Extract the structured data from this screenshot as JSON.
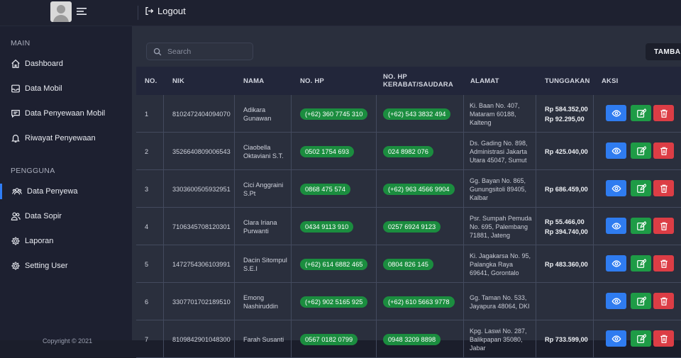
{
  "topbar": {
    "logout_label": "Logout"
  },
  "sidebar": {
    "sections": [
      {
        "label": "MAIN"
      },
      {
        "label": "PENGGUNA"
      }
    ],
    "items": [
      {
        "label": "Dashboard",
        "icon": "home-icon"
      },
      {
        "label": "Data Mobil",
        "icon": "inbox-icon"
      },
      {
        "label": "Data Penyewaan Mobil",
        "icon": "message-icon"
      },
      {
        "label": "Riwayat Penyewaan",
        "icon": "bell-icon"
      },
      {
        "label": "Data Penyewa",
        "icon": "users-icon",
        "active": true
      },
      {
        "label": "Data Sopir",
        "icon": "user-pair-icon"
      },
      {
        "label": "Laporan",
        "icon": "gear-icon"
      },
      {
        "label": "Setting User",
        "icon": "gear-icon"
      }
    ],
    "footer": "Copyright © 2021"
  },
  "main": {
    "search": {
      "placeholder": "Search"
    },
    "add_button": "TAMBAH",
    "table": {
      "headers": [
        "NO.",
        "NIK",
        "NAMA",
        "NO. HP",
        "NO. HP KERABAT/SAUDARA",
        "ALAMAT",
        "TUNGGAKAN",
        "AKSI"
      ],
      "rows": [
        {
          "no": "1",
          "nik": "8102472404094070",
          "nama": "Adikara Gunawan",
          "hp": "(+62) 360 7745 310",
          "hp_kerabat": "(+62) 543 3832 494",
          "alamat": "Ki. Baan No. 407, Mataram 60188, Kalteng",
          "tunggakan": [
            "Rp 584.352,00",
            "Rp 92.295,00"
          ]
        },
        {
          "no": "2",
          "nik": "3526640809006543",
          "nama": "Ciaobella Oktaviani S.T.",
          "hp": "0502 1754 693",
          "hp_kerabat": "024 8982 076",
          "alamat": "Ds. Gading No. 898, Administrasi Jakarta Utara 45047, Sumut",
          "tunggakan": [
            "Rp 425.040,00"
          ]
        },
        {
          "no": "3",
          "nik": "3303600505932951",
          "nama": "Cici Anggraini S.Pt",
          "hp": "0868 475 574",
          "hp_kerabat": "(+62) 963 4566 9904",
          "alamat": "Gg. Bayan No. 865, Gunungsitoli 89405, Kalbar",
          "tunggakan": [
            "Rp 686.459,00"
          ]
        },
        {
          "no": "4",
          "nik": "7106345708120301",
          "nama": "Clara Iriana Purwanti",
          "hp": "0434 9113 910",
          "hp_kerabat": "0257 6924 9123",
          "alamat": "Psr. Sumpah Pemuda No. 695, Palembang 71881, Jateng",
          "tunggakan": [
            "Rp 55.466,00",
            "Rp 394.740,00"
          ]
        },
        {
          "no": "5",
          "nik": "1472754306103991",
          "nama": "Dacin Sitompul S.E.I",
          "hp": "(+62) 614 6882 465",
          "hp_kerabat": "0804 826 145",
          "alamat": "Ki. Jagakarsa No. 95, Palangka Raya 69641, Gorontalo",
          "tunggakan": [
            "Rp 483.360,00"
          ]
        },
        {
          "no": "6",
          "nik": "3307701702189510",
          "nama": "Emong Nashiruddin",
          "hp": "(+62) 902 5165 925",
          "hp_kerabat": "(+62) 610 5663 9778",
          "alamat": "Gg. Taman No. 533, Jayapura 48064, DKI",
          "tunggakan": []
        },
        {
          "no": "7",
          "nik": "8109842901048300",
          "nama": "Farah Susanti",
          "hp": "0567 0182 0799",
          "hp_kerabat": "0948 3209 8898",
          "alamat": "Kpg. Laswi No. 287, Balikpapan 35080, Jabar",
          "tunggakan": [
            "Rp 733.599,00"
          ]
        }
      ]
    }
  },
  "colors": {
    "accent_blue": "#2f7cf0",
    "pill_green": "#1b8d3f",
    "danger_red": "#dc3d45",
    "edit_green": "#1e9b46"
  }
}
